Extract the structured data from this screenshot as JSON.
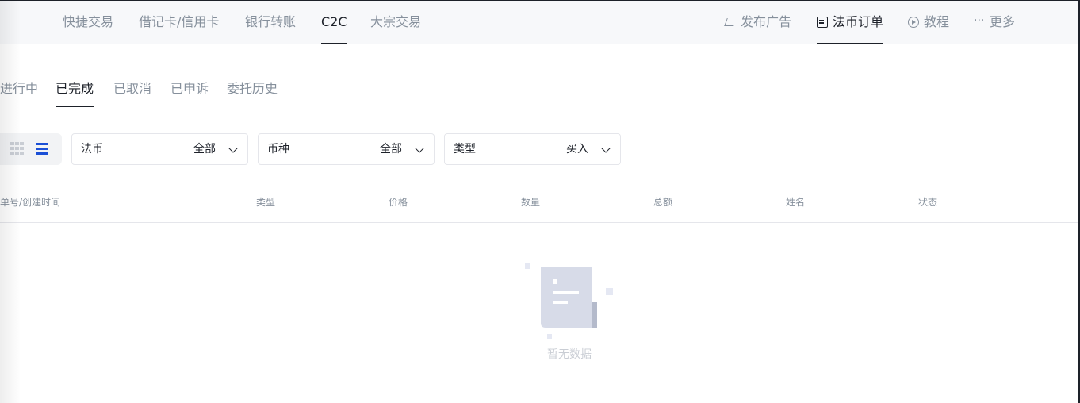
{
  "topnav": {
    "left_items": [
      {
        "label": "快捷交易",
        "active": false
      },
      {
        "label": "借记卡/信用卡",
        "active": false
      },
      {
        "label": "银行转账",
        "active": false
      },
      {
        "label": "C2C",
        "active": true
      },
      {
        "label": "大宗交易",
        "active": false
      }
    ],
    "right_items": [
      {
        "label": "发布广告",
        "icon": "send-icon",
        "active": false
      },
      {
        "label": "法币订单",
        "icon": "order-icon",
        "active": true
      },
      {
        "label": "教程",
        "icon": "play-circle-icon",
        "active": false
      },
      {
        "label": "更多",
        "icon": "more-dots-icon",
        "active": false
      }
    ]
  },
  "subtabs": [
    {
      "label": "进行中",
      "active": false
    },
    {
      "label": "已完成",
      "active": true
    },
    {
      "label": "已取消",
      "active": false
    },
    {
      "label": "已申诉",
      "active": false
    },
    {
      "label": "委托历史",
      "active": false
    }
  ],
  "view_toggle": {
    "selected": "list",
    "accent": "#1b4fd6"
  },
  "filters": [
    {
      "label": "法币",
      "value": "全部"
    },
    {
      "label": "币种",
      "value": "全部"
    },
    {
      "label": "类型",
      "value": "买入"
    }
  ],
  "table": {
    "columns": [
      "单号/创建时间",
      "类型",
      "价格",
      "数量",
      "总额",
      "姓名",
      "状态"
    ]
  },
  "empty_state": {
    "text": "暂无数据"
  }
}
